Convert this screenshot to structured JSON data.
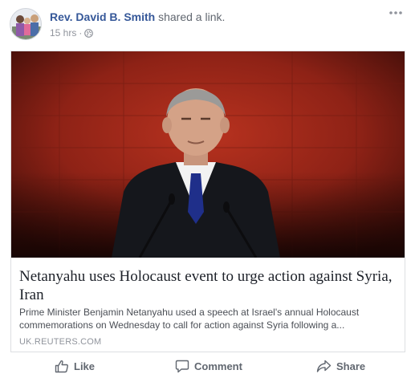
{
  "post": {
    "author": "Rev. David B. Smith",
    "action": "shared a link.",
    "time": "15 hrs",
    "privacy_icon": "globe-icon",
    "more_icon": "more-options-icon"
  },
  "link_card": {
    "headline": "Netanyahu uses Holocaust event to urge action against Syria, Iran",
    "description": "Prime Minister Benjamin Netanyahu used a speech at Israel's annual Holocaust commemorations on Wednesday to call for action against Syria following a...",
    "domain": "UK.REUTERS.COM",
    "image_icon": "speaker-at-podium-photo"
  },
  "actions": {
    "like": "Like",
    "comment": "Comment",
    "share": "Share"
  },
  "colors": {
    "author_link": "#365899",
    "secondary_text": "#90949c",
    "image_background": "#9a2418"
  }
}
